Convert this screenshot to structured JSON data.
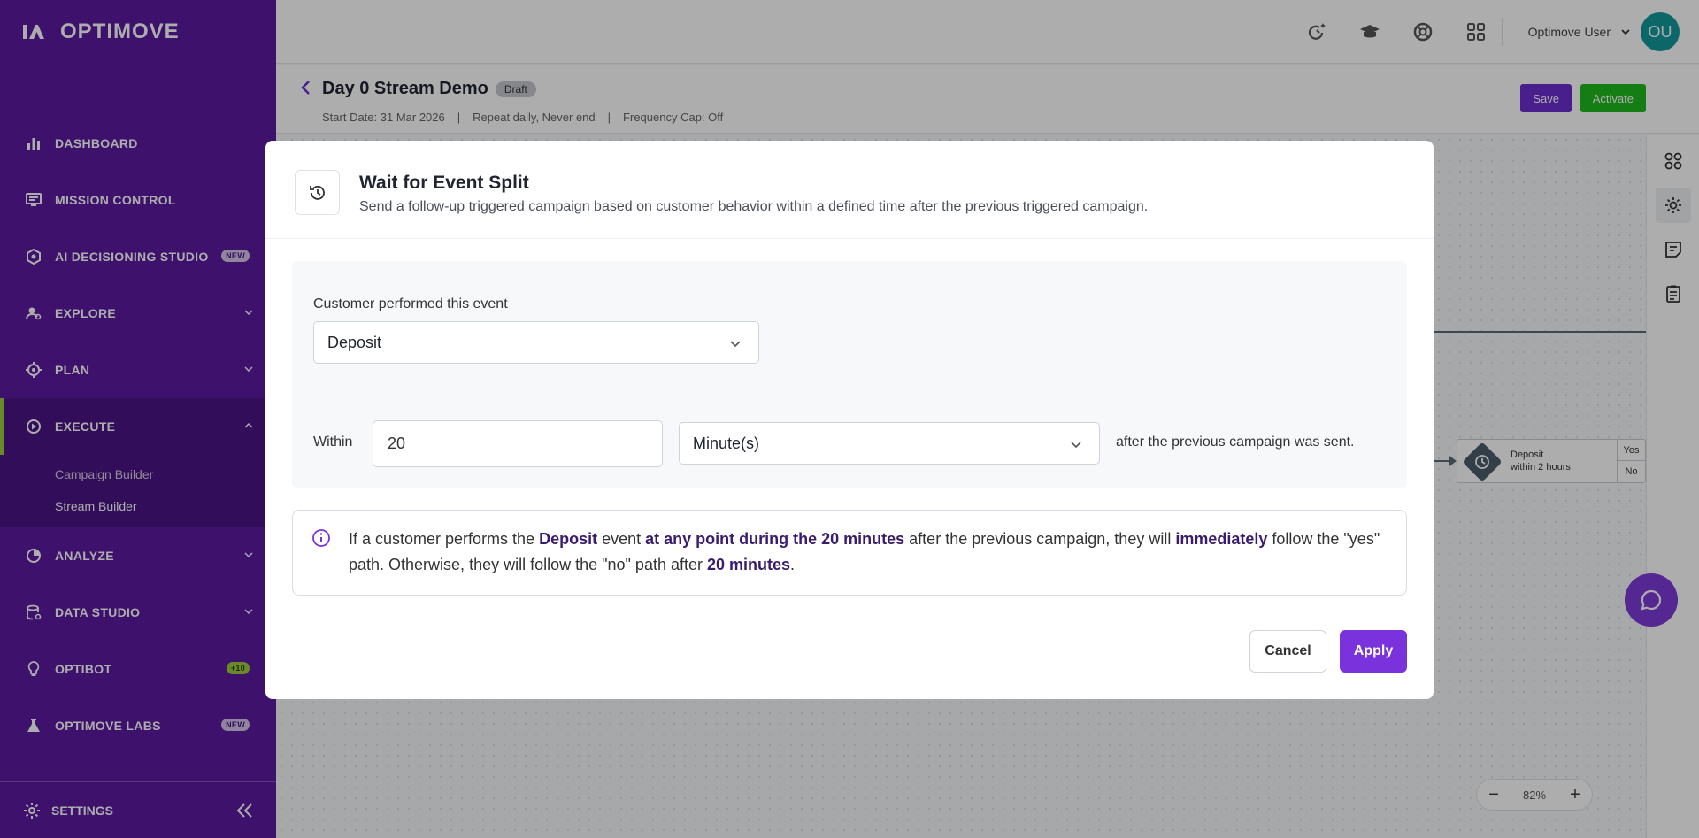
{
  "app": {
    "brand": "OPTIMOVE"
  },
  "sidebar": {
    "items": [
      {
        "label": "DASHBOARD",
        "icon": "bar-chart-icon"
      },
      {
        "label": "MISSION CONTROL",
        "icon": "monitor-icon"
      },
      {
        "label": "AI DECISIONING STUDIO",
        "icon": "hexagon-icon",
        "badge": "NEW"
      },
      {
        "label": "EXPLORE",
        "icon": "person-search-icon"
      },
      {
        "label": "PLAN",
        "icon": "target-icon"
      },
      {
        "label": "EXECUTE",
        "icon": "play-circle-icon"
      },
      {
        "label": "ANALYZE",
        "icon": "analyze-icon"
      },
      {
        "label": "DATA STUDIO",
        "icon": "database-icon"
      },
      {
        "label": "OPTIBOT",
        "icon": "lightbulb-icon",
        "badge": "+10"
      },
      {
        "label": "OPTIMOVE LABS",
        "icon": "flask-icon",
        "badge": "NEW"
      }
    ],
    "execute_sub": [
      "Campaign Builder",
      "Stream Builder"
    ],
    "settings_label": "SETTINGS"
  },
  "topbar": {
    "user_name": "Optimove User",
    "avatar_initials": "OU"
  },
  "stream": {
    "title": "Day 0 Stream Demo",
    "status": "Draft",
    "start_date": "Start Date: 31 Mar 2026",
    "separator": "|",
    "repeat": "Repeat daily, Never end",
    "frequency": "Frequency Cap: Off",
    "save_label": "Save",
    "activate_label": "Activate"
  },
  "canvas": {
    "node_line1": "Deposit",
    "node_line2": "within 2 hours",
    "yes": "Yes",
    "no": "No",
    "zoom": "82%"
  },
  "modal": {
    "title": "Wait for Event Split",
    "description": "Send a follow-up triggered campaign based on customer behavior within a defined time after the previous triggered campaign.",
    "event_label": "Customer performed this event",
    "event_value": "Deposit",
    "within_label": "Within",
    "within_value": "20",
    "unit_value": "Minute(s)",
    "after_label": "after the previous campaign was sent.",
    "info": {
      "p1": "If a customer performs the ",
      "b1": "Deposit",
      "p2": " event ",
      "b2": "at any point during the 20 minutes",
      "p3": " after the previous campaign, they will ",
      "b3": "immediately",
      "p4": " follow the \"yes\" path. Otherwise, they will follow the \"no\" path after ",
      "b4": "20 minutes",
      "p5": "."
    },
    "cancel_label": "Cancel",
    "apply_label": "Apply"
  },
  "colors": {
    "sidebar": "#5a1aa0",
    "accent": "#7a32dc",
    "activate": "#1eb81e",
    "badge_green": "#9ccc3d"
  }
}
